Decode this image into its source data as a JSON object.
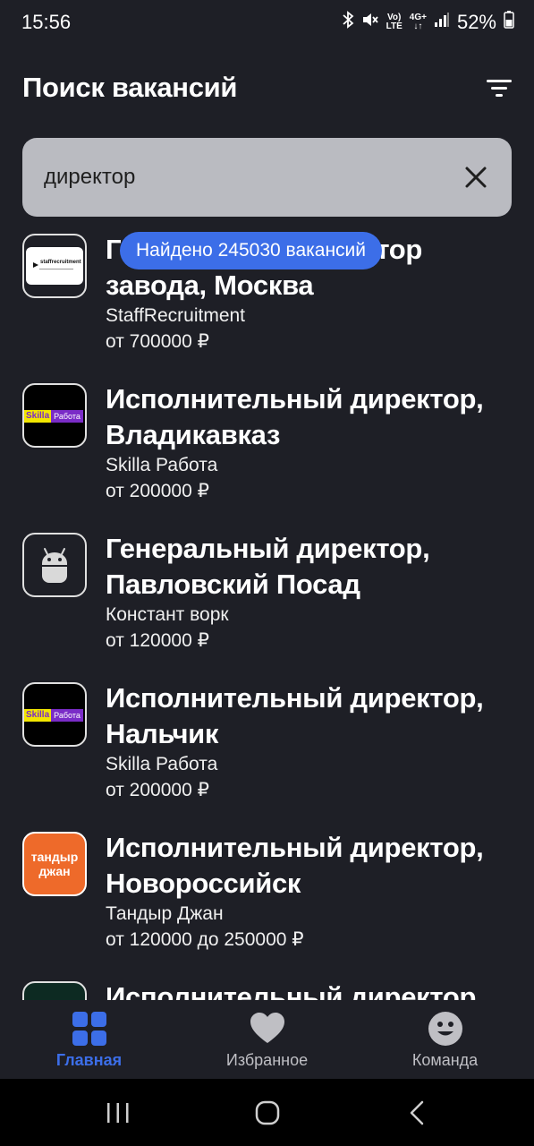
{
  "status_bar": {
    "time": "15:56",
    "network_top": "Vo)",
    "network_bottom": "LTE",
    "data_top": "4G+",
    "battery": "52%"
  },
  "header": {
    "title": "Поиск вакансий",
    "filter_icon": "filter-icon"
  },
  "search": {
    "value": "директор",
    "clear_icon": "close-icon"
  },
  "found_banner": "Найдено 245030 вакансий",
  "jobs": [
    {
      "title": "Генеральный директор завода, Москва",
      "company": "StaffRecruitment",
      "salary": "от 700000 ₽",
      "logo_text": "staffrecruitment"
    },
    {
      "title": "Исполнительный директор, Владикавказ",
      "company": "Skilla Работа",
      "salary": "от 200000 ₽",
      "logo_text_a": "Skilla",
      "logo_text_b": "Работа"
    },
    {
      "title": "Генеральный директор, Павловский Посад",
      "company": "Констант ворк",
      "salary": "от 120000 ₽",
      "logo_icon": "android-icon"
    },
    {
      "title": "Исполнительный директор, Нальчик",
      "company": "Skilla Работа",
      "salary": "от 200000 ₽",
      "logo_text_a": "Skilla",
      "logo_text_b": "Работа"
    },
    {
      "title": "Исполнительный директор, Новороссийск",
      "company": "Тандыр Джан",
      "salary": "от 120000 до 250000 ₽",
      "logo_text_a": "тандыр",
      "logo_text_b": "джан"
    },
    {
      "title": "Исполнительный директор"
    }
  ],
  "bottom_nav": {
    "items": [
      {
        "label": "Главная",
        "icon": "grid-icon",
        "active": true
      },
      {
        "label": "Избранное",
        "icon": "heart-icon",
        "active": false
      },
      {
        "label": "Команда",
        "icon": "smiley-icon",
        "active": false
      }
    ]
  },
  "colors": {
    "background": "#1e1f26",
    "accent": "#3c6ee8",
    "search_bg": "#babbc1"
  }
}
